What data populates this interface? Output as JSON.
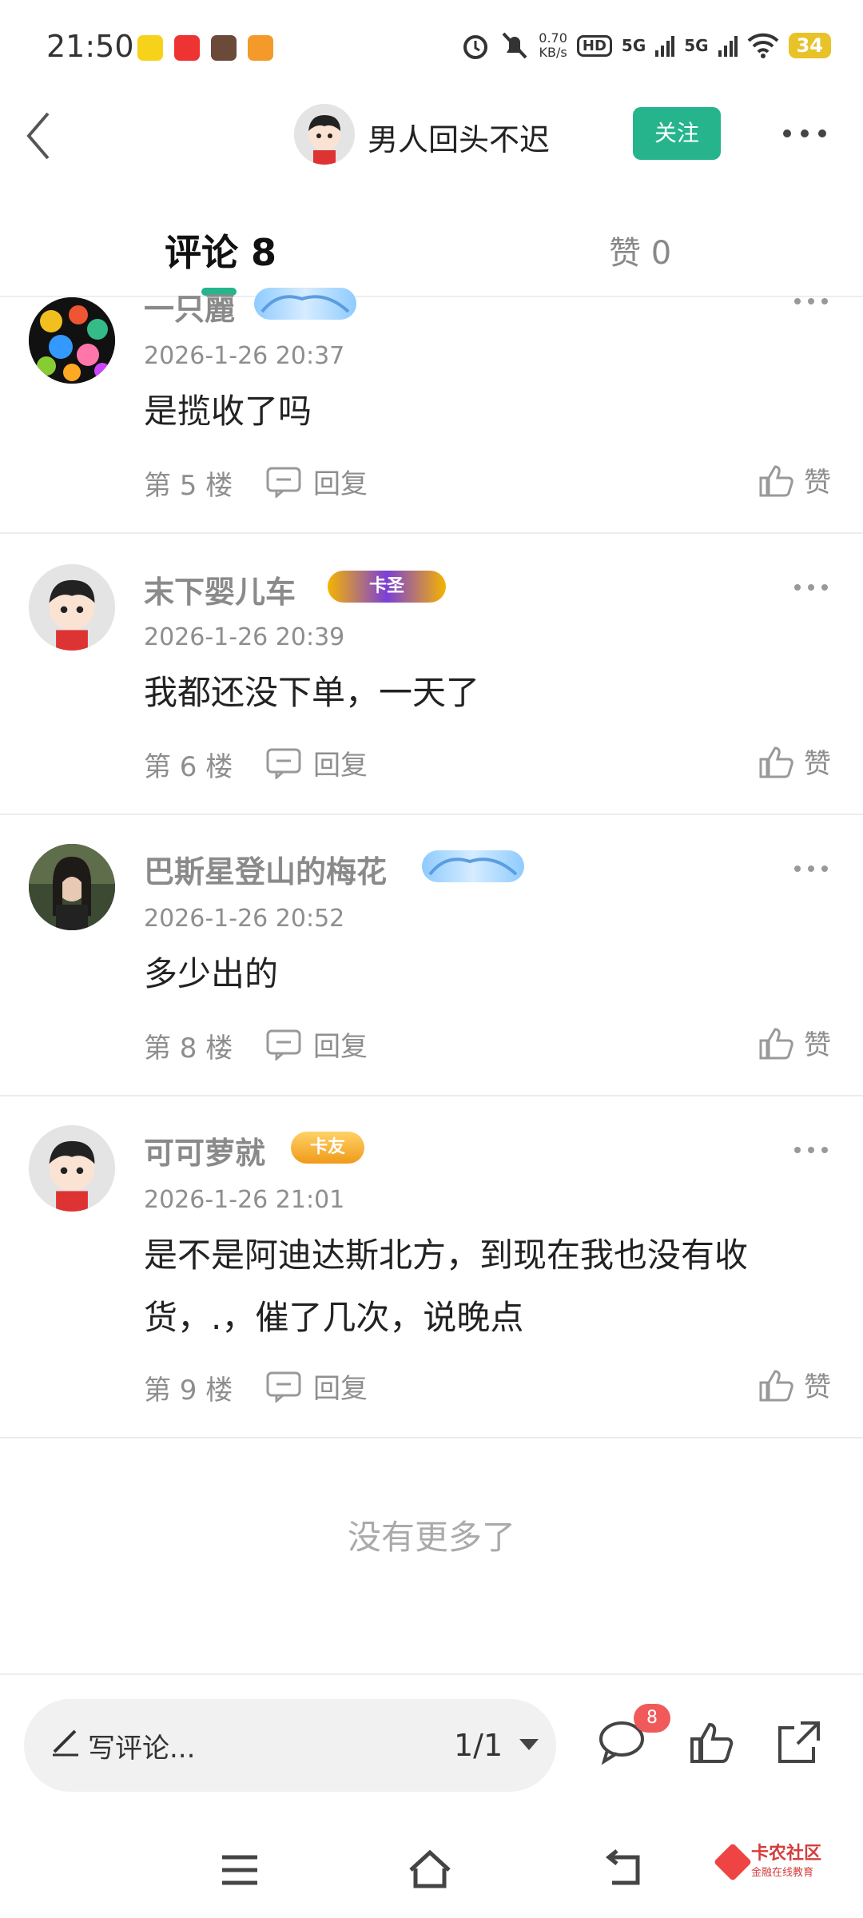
{
  "status_bar": {
    "time": "21:50",
    "net_speed_value": "0.70",
    "net_speed_unit": "KB/s",
    "hd_label": "HD",
    "signal1": "5G",
    "signal2": "5G",
    "battery": "34"
  },
  "header": {
    "title": "男人回头不迟",
    "follow_label": "关注"
  },
  "tabs": {
    "comments": "评论 8",
    "likes": "赞 0"
  },
  "comments": [
    {
      "name": "一只麗",
      "time": "2026-1-26 20:37",
      "text": "是揽收了吗",
      "floor": "第 5 楼",
      "reply": "回复",
      "like": "赞"
    },
    {
      "name": "末下婴儿车",
      "badge": "卡圣",
      "time": "2026-1-26 20:39",
      "text": "我都还没下单，一天了",
      "floor": "第 6 楼",
      "reply": "回复",
      "like": "赞"
    },
    {
      "name": "巴斯星登山的梅花",
      "time": "2026-1-26 20:52",
      "text": "多少出的",
      "floor": "第 8 楼",
      "reply": "回复",
      "like": "赞"
    },
    {
      "name": "可可萝就",
      "badge": "卡友",
      "time": "2026-1-26 21:01",
      "text": "是不是阿迪达斯北方，到现在我也没有收货，.，催了几次，说晚点",
      "floor": "第 9 楼",
      "reply": "回复",
      "like": "赞"
    }
  ],
  "no_more": "没有更多了",
  "bottom_bar": {
    "placeholder": "写评论...",
    "page": "1/1",
    "comment_count": "8"
  },
  "watermark": {
    "title": "卡农社区",
    "subtitle": "金融在线教育"
  },
  "colors": {
    "accent": "#26b48d",
    "badge_red": "#f05a5a"
  }
}
